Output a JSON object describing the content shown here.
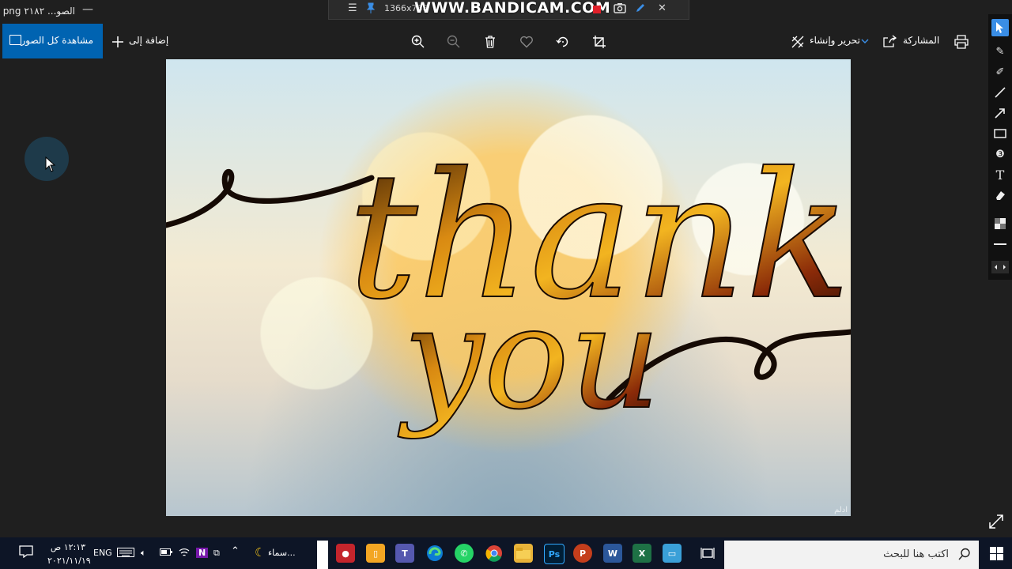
{
  "window": {
    "title": "الصو... ٢١٨٢ png",
    "minimize_glyph": "—"
  },
  "bandicam": {
    "resolution": "1366x768",
    "logo": "WWW.BANDICAM.COM"
  },
  "toolbar": {
    "view_all_label": "مشاهدة كل الصور",
    "add_to_label": "إضافة إلى",
    "edit_create_label": "تحرير وإنشاء",
    "share_label": "المشاركة"
  },
  "photo": {
    "line1": "thank",
    "line2": "you",
    "signature": "ادلم"
  },
  "taskbar": {
    "search_placeholder": "اكتب هنا للبحث",
    "weather_label": "سماء...",
    "lang": "ENG",
    "time": "١٢:١٣ ص",
    "date": "٢٠٢١/١١/١٩"
  },
  "colors": {
    "accent": "#0063b1",
    "background": "#1f1f1f",
    "taskbar": "#0d1526"
  }
}
